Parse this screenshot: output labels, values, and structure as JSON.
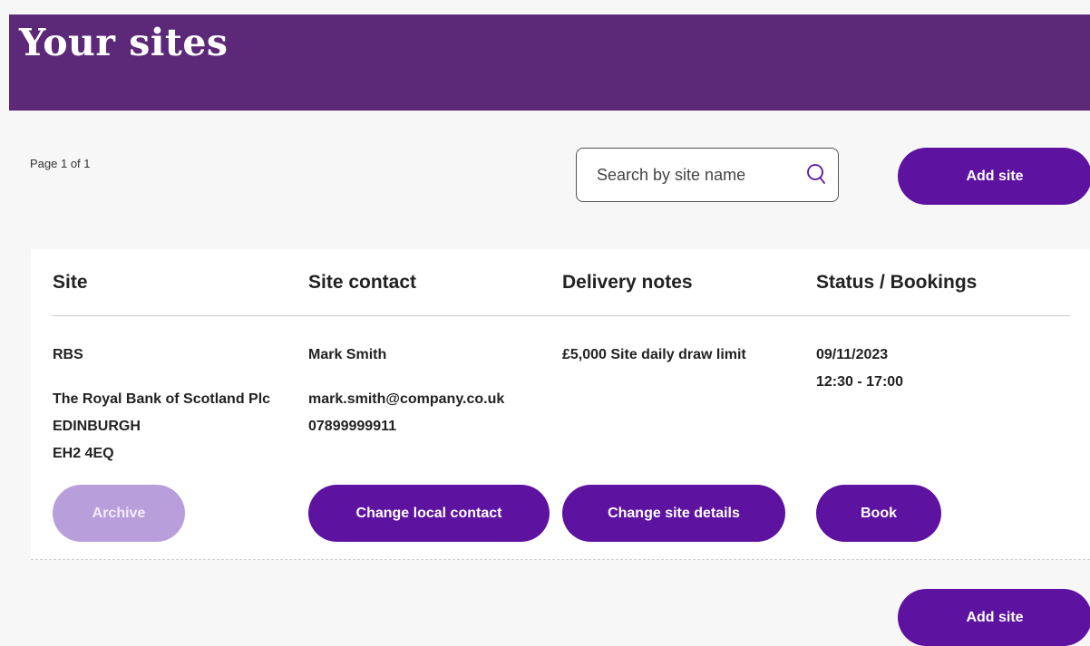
{
  "header": {
    "title": "Your sites"
  },
  "toolbar": {
    "page_info": "Page 1 of 1",
    "search_placeholder": "Search by site name",
    "add_site_label": "Add site"
  },
  "table": {
    "columns": [
      "Site",
      "Site contact",
      "Delivery notes",
      "Status / Bookings"
    ],
    "rows": [
      {
        "site_name": "RBS",
        "site_address": [
          "The Royal Bank of Scotland Plc",
          "EDINBURGH",
          "EH2 4EQ"
        ],
        "contact_name": "Mark Smith",
        "contact_email": "mark.smith@company.co.uk",
        "contact_phone": "07899999911",
        "delivery_notes": "£5,000 Site daily draw limit",
        "status_date": "09/11/2023",
        "status_time": "12:30 - 17:00",
        "actions": {
          "archive": "Archive",
          "change_contact": "Change local contact",
          "change_details": "Change site details",
          "book": "Book"
        }
      }
    ]
  },
  "footer": {
    "add_site_label": "Add site"
  },
  "colors": {
    "header_bg": "#5c2878",
    "primary_button": "#5d12a0",
    "disabled_button": "#b89fdc",
    "search_icon": "#5d12a0"
  }
}
